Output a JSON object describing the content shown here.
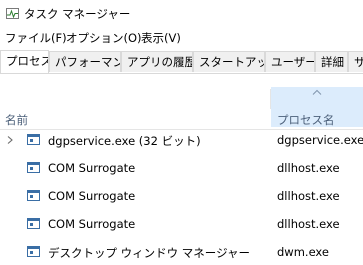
{
  "window": {
    "title": "タスク マネージャー"
  },
  "menu": {
    "items": [
      "ファイル(F)",
      "オプション(O)",
      "表示(V)"
    ]
  },
  "tabs": {
    "items": [
      "プロセス",
      "パフォーマンス",
      "アプリの履歴",
      "スタートアップ",
      "ユーザー",
      "詳細",
      "サ"
    ],
    "active": "プロセス"
  },
  "columns": {
    "name": "名前",
    "process_name": "プロセス名",
    "sort_indicator": "chevron-up-icon"
  },
  "processes": [
    {
      "name": "dgpservice.exe (32 ビット)",
      "process_name": "dgpservice.exe",
      "expandable": true,
      "icon": "process-window-icon"
    },
    {
      "name": "COM Surrogate",
      "process_name": "dllhost.exe",
      "expandable": false,
      "icon": "process-window-icon"
    },
    {
      "name": "COM Surrogate",
      "process_name": "dllhost.exe",
      "expandable": false,
      "icon": "process-window-icon"
    },
    {
      "name": "COM Surrogate",
      "process_name": "dllhost.exe",
      "expandable": false,
      "icon": "process-window-icon"
    },
    {
      "name": "デスクトップ ウィンドウ マネージャー",
      "process_name": "dwm.exe",
      "expandable": false,
      "icon": "process-window-icon"
    }
  ],
  "colors": {
    "header_highlight": "#dcecfc",
    "header_text": "#4c607a",
    "icon_blue": "#3a6ea5",
    "tab_inactive_bg": "#f0f0f0",
    "border": "#d9d9d9"
  }
}
